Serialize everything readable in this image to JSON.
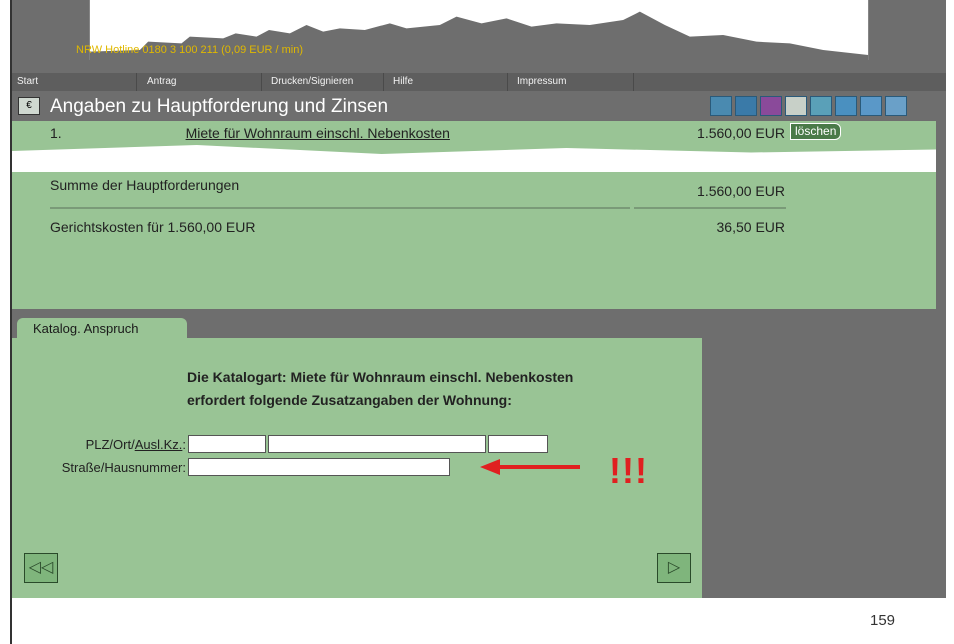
{
  "header": {
    "hotline": "NRW Hotline 0180 3 100 211 (0,09 EUR / min)"
  },
  "menu": [
    "Start",
    "Antrag",
    "Drucken/Signieren",
    "Hilfe",
    "Impressum"
  ],
  "title": "Angaben zu Hauptforderung und Zinsen",
  "toolbar_icons": [
    "people-icon",
    "people-icon",
    "people-icon",
    "money-icon",
    "help-icon",
    "list-icon",
    "document-icon",
    "save-icon"
  ],
  "claims": {
    "row1_prefix": "1.",
    "row1_link": "Miete für Wohnraum einschl. Nebenkosten",
    "row1_value": "1.560,00 EUR",
    "delete_label": "löschen",
    "sum_label": "Summe der Hauptforderungen",
    "sum_value": "1.560,00 EUR",
    "court_label": "Gerichtskosten für 1.560,00 EUR",
    "court_value": "36,50 EUR"
  },
  "tab": "Katalog. Anspruch",
  "info": {
    "line1": "Die Katalogart: Miete für Wohnraum einschl. Nebenkosten",
    "line2": "erfordert folgende Zusatzangaben der Wohnung:"
  },
  "form": {
    "plz_label_prefix": "PLZ/Ort/",
    "plz_label_link": "Ausl.Kz.",
    "plz_label_suffix": ":",
    "street_label": "Straße/Hausnummer:"
  },
  "annotation": "!!!",
  "nav": {
    "back": "◁◁",
    "next": "▷"
  },
  "page_number": "159",
  "colors": {
    "panel": "#99c495",
    "frame": "#6e6e6e",
    "accent": "#e02020"
  }
}
